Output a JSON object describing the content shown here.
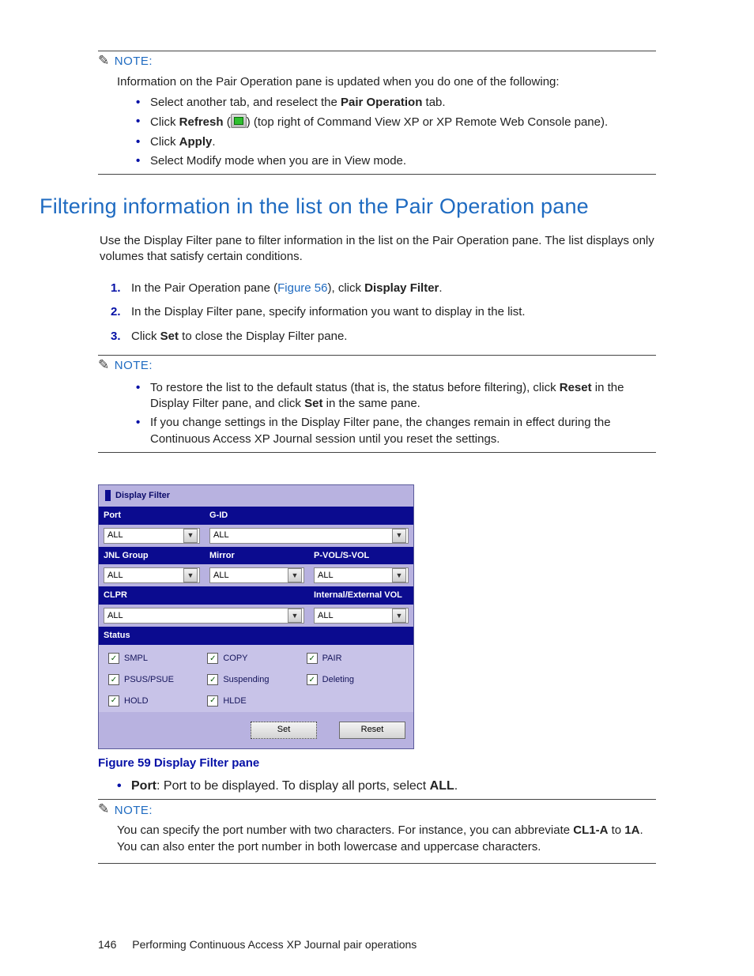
{
  "note1": {
    "label": "NOTE:",
    "lead": "Information on the Pair Operation pane is updated when you do one of the following:",
    "items": {
      "a_pre": "Select another tab, and reselect the ",
      "a_bold": "Pair Operation",
      "a_post": " tab.",
      "b_pre": "Click ",
      "b_bold": "Refresh",
      "b_post": " (",
      "b_tail": ") (top right of Command View XP or XP Remote Web Console pane).",
      "c_pre": "Click ",
      "c_bold": "Apply",
      "c_post": ".",
      "d": "Select Modify mode when you are in View mode."
    }
  },
  "section": {
    "title": "Filtering information in the list on the Pair Operation pane",
    "lead": "Use the Display Filter pane to filter information in the list on the Pair Operation pane. The list displays only volumes that satisfy certain conditions.",
    "steps": {
      "s1_pre": "In the Pair Operation pane (",
      "s1_link": "Figure 56",
      "s1_mid": "), click ",
      "s1_bold": "Display Filter",
      "s1_post": ".",
      "s2": "In the Display Filter pane, specify information you want to display in the list.",
      "s3_pre": "Click ",
      "s3_bold": "Set",
      "s3_post": " to close the Display Filter pane."
    }
  },
  "note2": {
    "label": "NOTE:",
    "items": {
      "a_pre": "To restore the list to the default status (that is, the status before filtering), click ",
      "a_b1": "Reset",
      "a_mid": " in the Display Filter pane, and click ",
      "a_b2": "Set",
      "a_post": " in the same pane.",
      "b": "If you change settings in the Display Filter pane, the changes remain in effect during the Continuous Access XP Journal session until you reset the settings."
    }
  },
  "filter": {
    "title": "Display Filter",
    "headers": {
      "port": "Port",
      "gid": "G-ID",
      "jnlgroup": "JNL Group",
      "mirror": "Mirror",
      "pvol": "P-VOL/S-VOL",
      "clpr": "CLPR",
      "intext": "Internal/External VOL",
      "status": "Status"
    },
    "all": "ALL",
    "statuses": [
      [
        "SMPL",
        "COPY",
        "PAIR"
      ],
      [
        "PSUS/PSUE",
        "Suspending",
        "Deleting"
      ],
      [
        "HOLD",
        "HLDE",
        ""
      ]
    ],
    "buttons": {
      "set": "Set",
      "reset": "Reset"
    }
  },
  "figure_caption": "Figure 59 Display Filter pane",
  "desc": {
    "port_label": "Port",
    "port_text_pre": ": Port to be displayed. To display all ports, select ",
    "port_bold": "ALL",
    "port_post": "."
  },
  "note3": {
    "label": "NOTE:",
    "text_pre": "You can specify the port number with two characters. For instance, you can abbreviate ",
    "b1": "CL1-A",
    "mid": " to ",
    "b2": "1A",
    "post": ". You can also enter the port number in both lowercase and uppercase characters."
  },
  "footer": {
    "pageno": "146",
    "title": "Performing Continuous Access XP Journal pair operations"
  }
}
